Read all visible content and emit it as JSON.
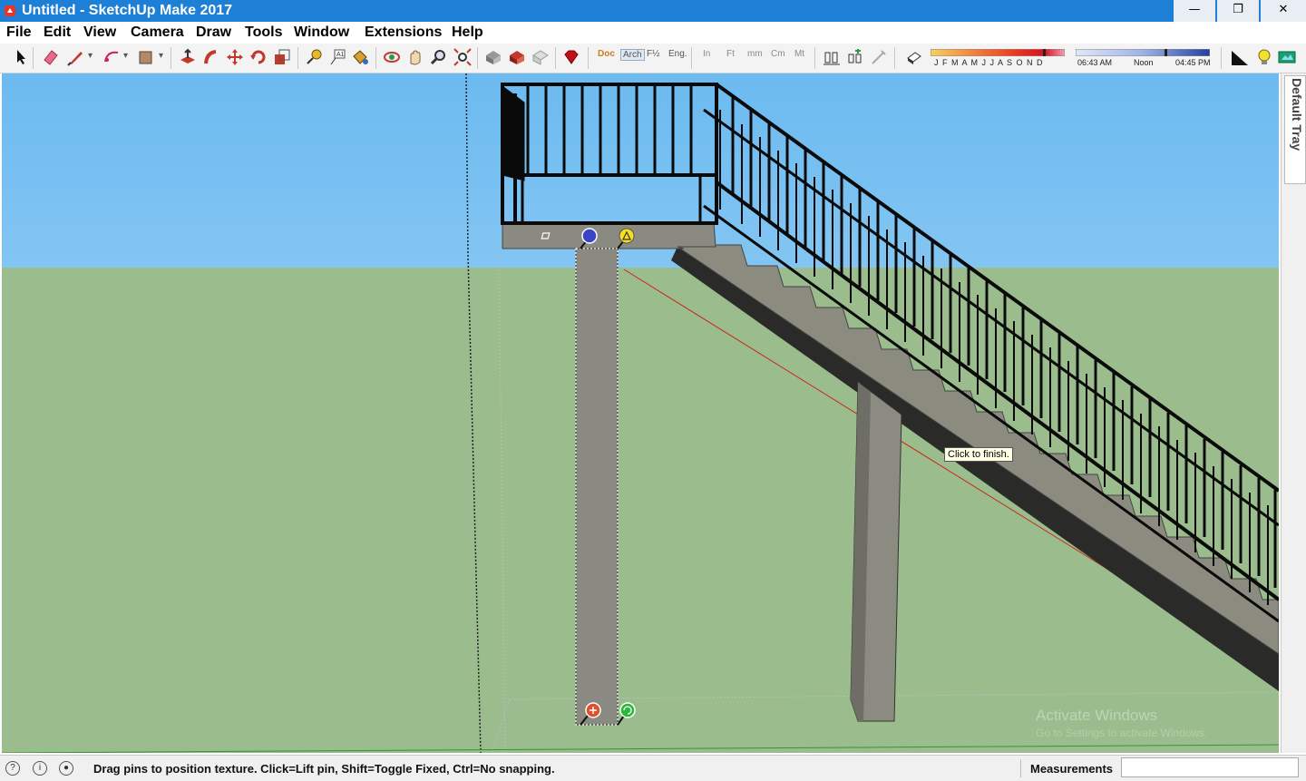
{
  "window": {
    "title": "Untitled - SketchUp Make 2017",
    "controls": {
      "minimize": "—",
      "maximize": "❐",
      "close": "✕"
    }
  },
  "menu": {
    "items": [
      {
        "label": "File"
      },
      {
        "label": "Edit"
      },
      {
        "label": "View"
      },
      {
        "label": "Camera"
      },
      {
        "label": "Draw"
      },
      {
        "label": "Tools"
      },
      {
        "label": "Window"
      },
      {
        "label": "Extensions"
      },
      {
        "label": "Help"
      }
    ]
  },
  "toolbar": {
    "tools": [
      "select-icon",
      "eraser-icon",
      "line-icon",
      "arc-icon",
      "rectangle-icon",
      "push-pull-icon",
      "follow-me-icon",
      "move-icon",
      "rotate-icon",
      "scale-icon",
      "tape-measure-icon",
      "text-icon",
      "paint-bucket-icon",
      "orbit-icon",
      "pan-icon",
      "zoom-icon",
      "zoom-extents-icon",
      "3d-warehouse-icon",
      "extension-warehouse-icon",
      "layout-icon",
      "ruby-icon"
    ],
    "unit_tools": [
      "Doc",
      "Arch",
      "F½",
      "Eng.",
      "In",
      "Ft",
      "mm",
      "Cm",
      "Mt"
    ],
    "shadow": {
      "months": "J F M A M J J A S O N D",
      "time_start": "06:43 AM",
      "time_mid": "Noon",
      "time_end": "04:45 PM"
    }
  },
  "viewport": {
    "tooltip": "Click to finish.",
    "watermark_title": "Activate Windows",
    "watermark_sub": "Go to Settings to activate Windows."
  },
  "tray": {
    "label": "Default Tray"
  },
  "status": {
    "message": "Drag pins to position texture.  Click=Lift pin, Shift=Toggle Fixed, Ctrl=No snapping.",
    "measurements_label": "Measurements",
    "measurements_value": ""
  },
  "colors": {
    "titlebar": "#1e7fd6",
    "sky_top": "#6bbaf0",
    "ground": "#9bbd8d",
    "concrete": "#8e8e86",
    "railing": "#0a0a0a"
  }
}
